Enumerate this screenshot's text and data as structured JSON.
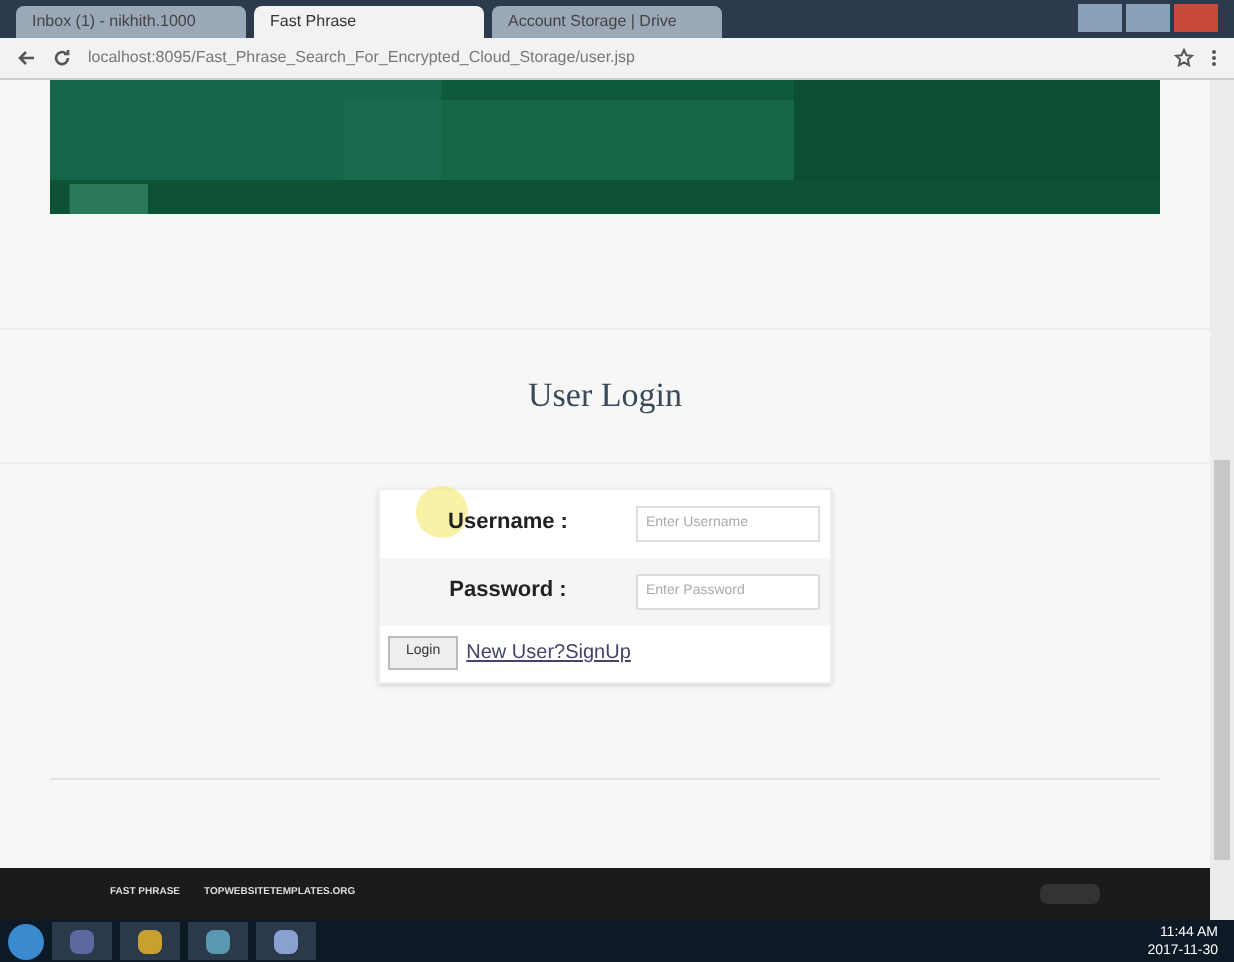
{
  "browser": {
    "tabs": [
      {
        "title": "Inbox (1) - nikhith.1000",
        "selected": false
      },
      {
        "title": "Fast Phrase",
        "selected": true
      },
      {
        "title": "Account Storage | Drive",
        "selected": false
      }
    ],
    "url": "localhost:8095/Fast_Phrase_Search_For_Encrypted_Cloud_Storage/user.jsp"
  },
  "page": {
    "heading": "User Login",
    "fields": [
      {
        "label": "Username :",
        "placeholder": "Enter Username"
      },
      {
        "label": "Password :",
        "placeholder": "Enter Password"
      }
    ],
    "login_button": "Login",
    "signup_link": "New User?SignUp"
  },
  "footer": {
    "brand": "FAST PHRASE",
    "credit": "TOPWEBSITETEMPLATES.ORG"
  },
  "taskbar": {
    "time": "11:44 AM",
    "date": "2017-11-30"
  }
}
